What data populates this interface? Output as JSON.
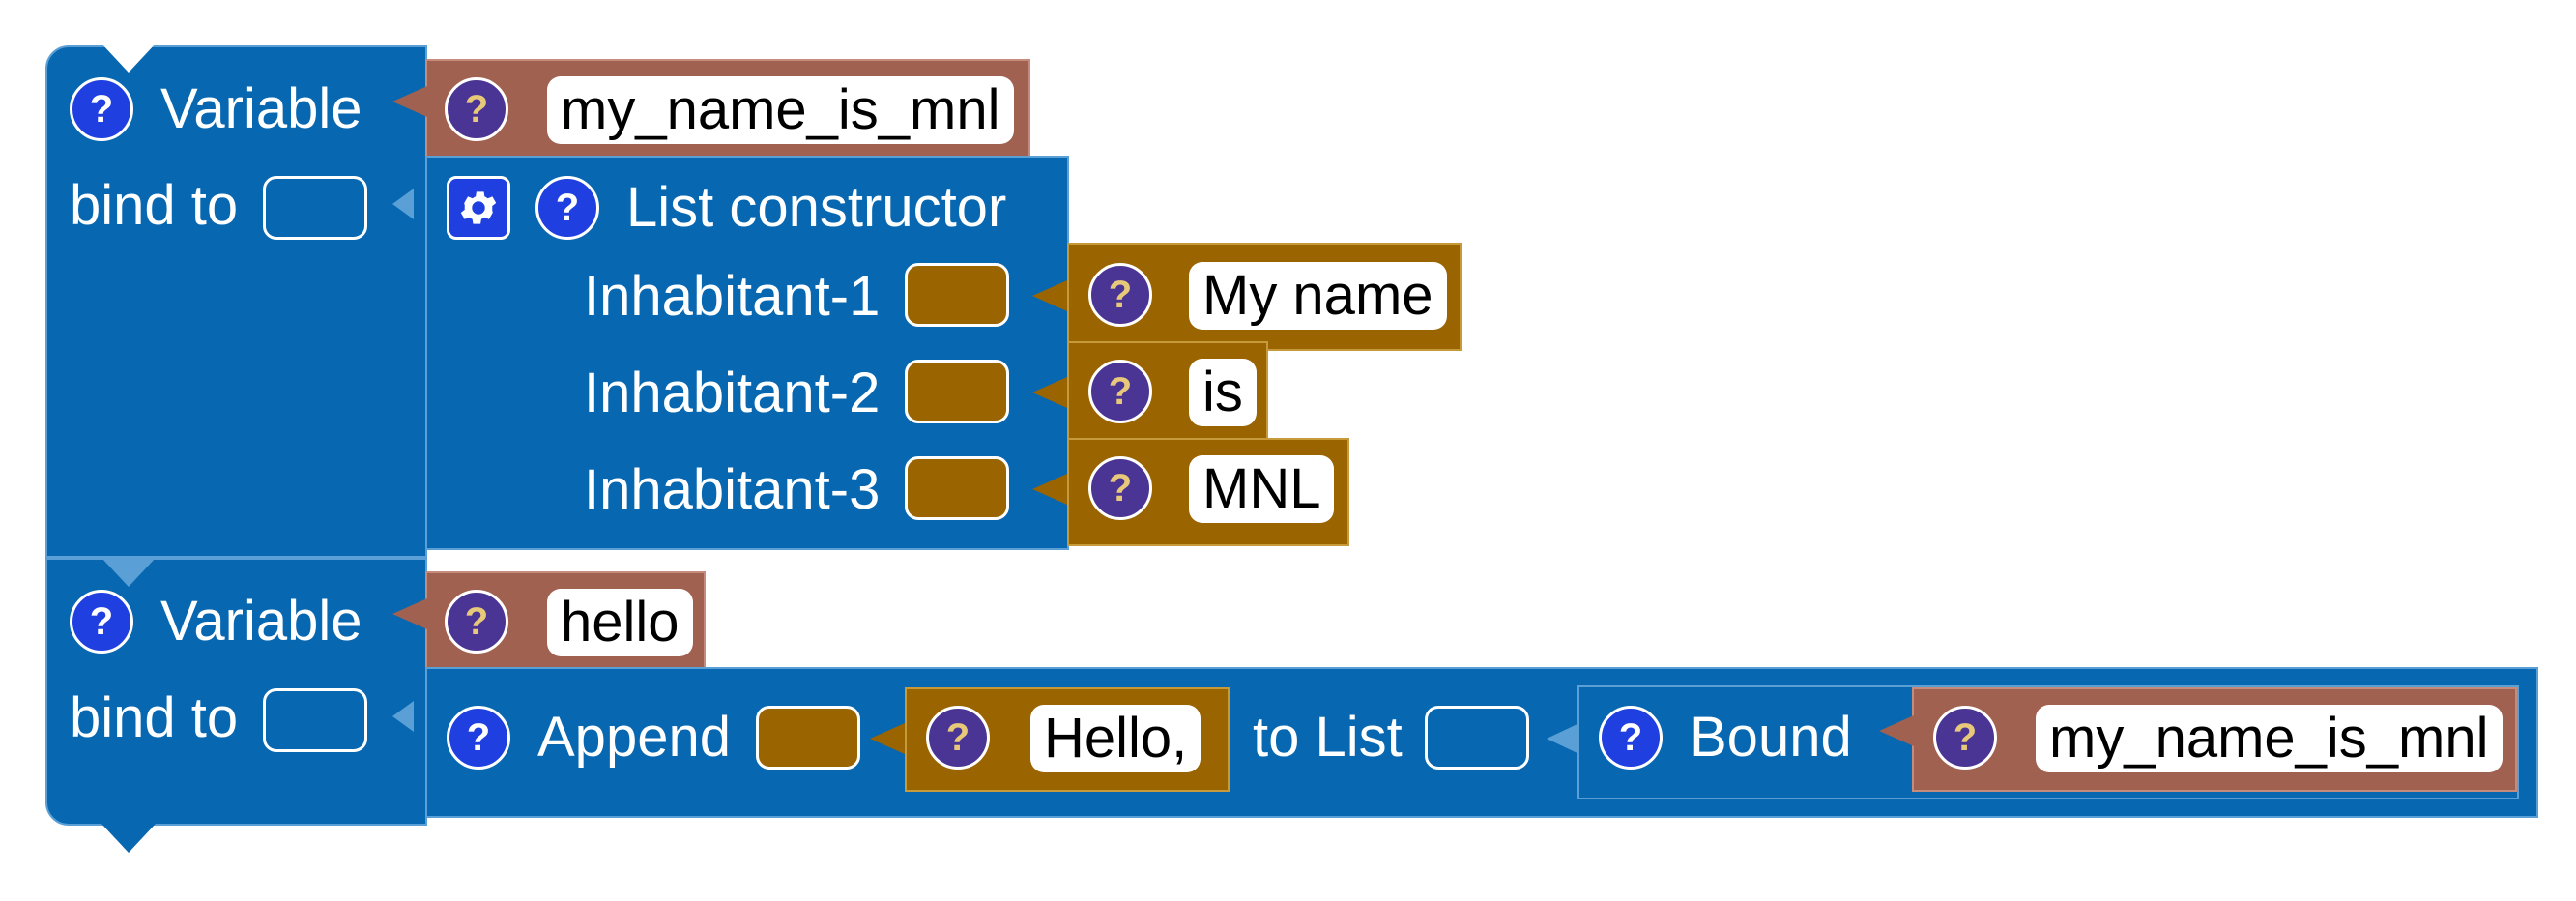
{
  "blocks": {
    "var1": {
      "label": "Variable",
      "bind_label": "bind to",
      "name": "my_name_is_mnl"
    },
    "list_constructor": {
      "label": "List constructor",
      "items": [
        {
          "label": "Inhabitant-1",
          "value": "My name"
        },
        {
          "label": "Inhabitant-2",
          "value": "is"
        },
        {
          "label": "Inhabitant-3",
          "value": "MNL"
        }
      ]
    },
    "var2": {
      "label": "Variable",
      "bind_label": "bind to",
      "name": "hello"
    },
    "append": {
      "label": "Append",
      "value": "Hello,",
      "to_list_label": "to List"
    },
    "bound": {
      "label": "Bound",
      "name": "my_name_is_mnl"
    },
    "help_glyph": "?"
  },
  "colors": {
    "statement_blue": "#0767b1",
    "variable_brown": "#a16150",
    "text_gold": "#9a6400",
    "help_icon_blue": "#1f3fe0",
    "help_icon_purple": "#4a3595"
  },
  "icons": [
    "help-icon",
    "gear-icon"
  ]
}
